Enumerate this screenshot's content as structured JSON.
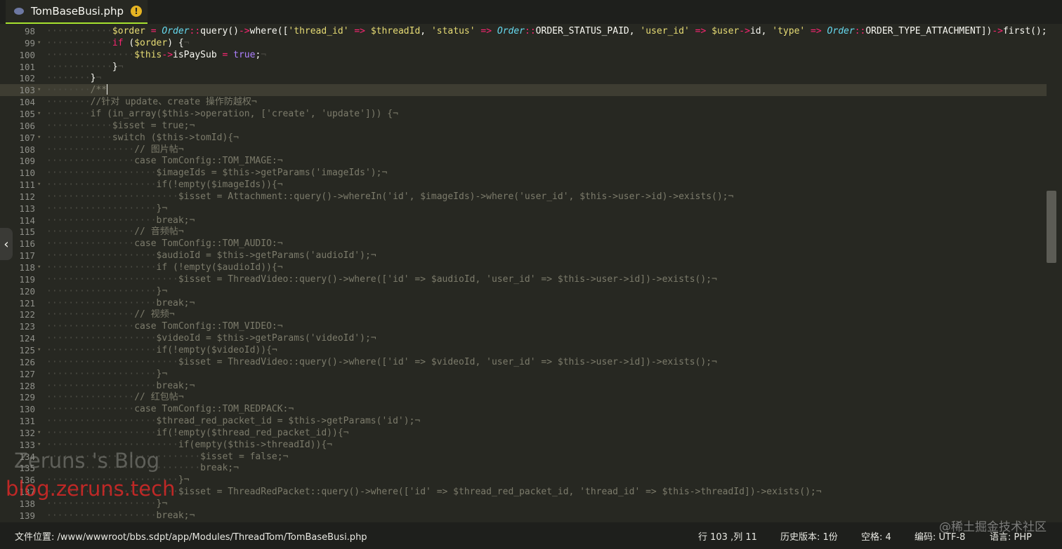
{
  "tab": {
    "filename": "TomBaseBusi.php",
    "warn_icon": "warning-icon",
    "file_icon": "php-elephant-icon"
  },
  "editor": {
    "current_line": 103,
    "lines": [
      {
        "n": "98",
        "fold": false,
        "indent": 3,
        "active": true,
        "tokens": [
          {
            "t": "$order",
            "c": "t-var"
          },
          {
            "t": " = ",
            "c": "t-op"
          },
          {
            "t": "Order",
            "c": "t-cls"
          },
          {
            "t": "::",
            "c": "t-op"
          },
          {
            "t": "query()",
            "c": "t-fn"
          },
          {
            "t": "->",
            "c": "t-op"
          },
          {
            "t": "where([",
            "c": "t-fn"
          },
          {
            "t": "'thread_id'",
            "c": "t-str"
          },
          {
            "t": " => ",
            "c": "t-op"
          },
          {
            "t": "$threadId",
            "c": "t-var"
          },
          {
            "t": ", ",
            "c": "t-pl"
          },
          {
            "t": "'status'",
            "c": "t-str"
          },
          {
            "t": " => ",
            "c": "t-op"
          },
          {
            "t": "Order",
            "c": "t-cls"
          },
          {
            "t": "::",
            "c": "t-op"
          },
          {
            "t": "ORDER_STATUS_PAID, ",
            "c": "t-pl"
          },
          {
            "t": "'user_id'",
            "c": "t-str"
          },
          {
            "t": " => ",
            "c": "t-op"
          },
          {
            "t": "$user",
            "c": "t-var"
          },
          {
            "t": "->",
            "c": "t-op"
          },
          {
            "t": "id, ",
            "c": "t-pl"
          },
          {
            "t": "'type'",
            "c": "t-str"
          },
          {
            "t": " => ",
            "c": "t-op"
          },
          {
            "t": "Order",
            "c": "t-cls"
          },
          {
            "t": "::",
            "c": "t-op"
          },
          {
            "t": "ORDER_TYPE_ATTACHMENT])",
            "c": "t-pl"
          },
          {
            "t": "->",
            "c": "t-op"
          },
          {
            "t": "first();",
            "c": "t-pl"
          }
        ]
      },
      {
        "n": "99",
        "fold": true,
        "indent": 3,
        "active": true,
        "tokens": [
          {
            "t": "if",
            "c": "t-kw"
          },
          {
            "t": " (",
            "c": "t-pl"
          },
          {
            "t": "$order",
            "c": "t-var"
          },
          {
            "t": ") {",
            "c": "t-pl"
          },
          {
            "t": "¬",
            "c": "guide"
          }
        ]
      },
      {
        "n": "100",
        "fold": false,
        "indent": 4,
        "active": true,
        "tokens": [
          {
            "t": "$this",
            "c": "t-var"
          },
          {
            "t": "->",
            "c": "t-op"
          },
          {
            "t": "isPaySub",
            "c": "t-pl"
          },
          {
            "t": " = ",
            "c": "t-op"
          },
          {
            "t": "true",
            "c": "t-const"
          },
          {
            "t": ";",
            "c": "t-pl"
          },
          {
            "t": "¬",
            "c": "guide"
          }
        ]
      },
      {
        "n": "101",
        "fold": false,
        "indent": 3,
        "active": true,
        "tokens": [
          {
            "t": "}",
            "c": "t-pl"
          },
          {
            "t": "¬",
            "c": "guide"
          }
        ]
      },
      {
        "n": "102",
        "fold": false,
        "indent": 2,
        "active": true,
        "tokens": [
          {
            "t": "}",
            "c": "t-pl"
          },
          {
            "t": "¬",
            "c": "guide"
          }
        ]
      },
      {
        "n": "103",
        "fold": true,
        "indent": 2,
        "active": true,
        "cursor": true,
        "tokens": [
          {
            "t": "/**",
            "c": "code-dim"
          }
        ]
      },
      {
        "n": "104",
        "fold": false,
        "indent": 2,
        "active": false,
        "text": "//针对 update、create 操作防越权¬"
      },
      {
        "n": "105",
        "fold": true,
        "indent": 2,
        "active": false,
        "text": "if (in_array($this->operation, ['create', 'update'])) {¬"
      },
      {
        "n": "106",
        "fold": false,
        "indent": 3,
        "active": false,
        "text": "$isset = true;¬"
      },
      {
        "n": "107",
        "fold": true,
        "indent": 3,
        "active": false,
        "text": "switch ($this->tomId){¬"
      },
      {
        "n": "108",
        "fold": false,
        "indent": 4,
        "active": false,
        "text": "// 图片帖¬"
      },
      {
        "n": "109",
        "fold": false,
        "indent": 4,
        "active": false,
        "text": "case TomConfig::TOM_IMAGE:¬"
      },
      {
        "n": "110",
        "fold": false,
        "indent": 5,
        "active": false,
        "text": "$imageIds = $this->getParams('imageIds');¬"
      },
      {
        "n": "111",
        "fold": true,
        "indent": 5,
        "active": false,
        "text": "if(!empty($imageIds)){¬"
      },
      {
        "n": "112",
        "fold": false,
        "indent": 6,
        "active": false,
        "text": "$isset = Attachment::query()->whereIn('id', $imageIds)->where('user_id', $this->user->id)->exists();¬"
      },
      {
        "n": "113",
        "fold": false,
        "indent": 5,
        "active": false,
        "text": "}¬"
      },
      {
        "n": "114",
        "fold": false,
        "indent": 5,
        "active": false,
        "text": "break;¬"
      },
      {
        "n": "115",
        "fold": false,
        "indent": 4,
        "active": false,
        "text": "// 音频帖¬"
      },
      {
        "n": "116",
        "fold": false,
        "indent": 4,
        "active": false,
        "text": "case TomConfig::TOM_AUDIO:¬"
      },
      {
        "n": "117",
        "fold": false,
        "indent": 5,
        "active": false,
        "text": "$audioId = $this->getParams('audioId');¬"
      },
      {
        "n": "118",
        "fold": true,
        "indent": 5,
        "active": false,
        "text": "if (!empty($audioId)){¬"
      },
      {
        "n": "119",
        "fold": false,
        "indent": 6,
        "active": false,
        "text": "$isset = ThreadVideo::query()->where(['id' => $audioId, 'user_id' => $this->user->id])->exists();¬"
      },
      {
        "n": "120",
        "fold": false,
        "indent": 5,
        "active": false,
        "text": "}¬"
      },
      {
        "n": "121",
        "fold": false,
        "indent": 5,
        "active": false,
        "text": "break;¬"
      },
      {
        "n": "122",
        "fold": false,
        "indent": 4,
        "active": false,
        "text": "// 视频¬"
      },
      {
        "n": "123",
        "fold": false,
        "indent": 4,
        "active": false,
        "text": "case TomConfig::TOM_VIDEO:¬"
      },
      {
        "n": "124",
        "fold": false,
        "indent": 5,
        "active": false,
        "text": "$videoId = $this->getParams('videoId');¬"
      },
      {
        "n": "125",
        "fold": true,
        "indent": 5,
        "active": false,
        "text": "if(!empty($videoId)){¬"
      },
      {
        "n": "126",
        "fold": false,
        "indent": 6,
        "active": false,
        "text": "$isset = ThreadVideo::query()->where(['id' => $videoId, 'user_id' => $this->user->id])->exists();¬"
      },
      {
        "n": "127",
        "fold": false,
        "indent": 5,
        "active": false,
        "text": "}¬"
      },
      {
        "n": "128",
        "fold": false,
        "indent": 5,
        "active": false,
        "text": "break;¬"
      },
      {
        "n": "129",
        "fold": false,
        "indent": 4,
        "active": false,
        "text": "// 红包帖¬"
      },
      {
        "n": "130",
        "fold": false,
        "indent": 4,
        "active": false,
        "text": "case TomConfig::TOM_REDPACK:¬"
      },
      {
        "n": "131",
        "fold": false,
        "indent": 5,
        "active": false,
        "text": "$thread_red_packet_id = $this->getParams('id');¬"
      },
      {
        "n": "132",
        "fold": true,
        "indent": 5,
        "active": false,
        "text": "if(!empty($thread_red_packet_id)){¬"
      },
      {
        "n": "133",
        "fold": true,
        "indent": 6,
        "active": false,
        "text": "if(empty($this->threadId)){¬"
      },
      {
        "n": "134",
        "fold": false,
        "indent": 7,
        "active": false,
        "text": "$isset = false;¬"
      },
      {
        "n": "135",
        "fold": false,
        "indent": 7,
        "active": false,
        "text": "break;¬"
      },
      {
        "n": "136",
        "fold": false,
        "indent": 6,
        "active": false,
        "text": "}¬"
      },
      {
        "n": "137",
        "fold": false,
        "indent": 6,
        "active": false,
        "text": "$isset = ThreadRedPacket::query()->where(['id' => $thread_red_packet_id, 'thread_id' => $this->threadId])->exists();¬"
      },
      {
        "n": "138",
        "fold": false,
        "indent": 5,
        "active": false,
        "text": "}¬"
      },
      {
        "n": "139",
        "fold": false,
        "indent": 5,
        "active": false,
        "text": "break;¬"
      }
    ]
  },
  "watermarks": {
    "blog_name": "Zeruns 's Blog",
    "blog_url": "blog.zeruns.tech",
    "community": "@稀土掘金技术社区"
  },
  "sidebar_toggle": {
    "icon": "chevron-left-icon",
    "glyph": "‹"
  },
  "statusbar": {
    "file_location": "文件位置: /www/wwwroot/bbs.sdpt/app/Modules/ThreadTom/TomBaseBusi.php",
    "cursor_position": "行 103 ,列 11",
    "history": "历史版本: 1份",
    "indent": "空格: 4",
    "encoding": "编码: UTF-8",
    "language": "语言: PHP"
  }
}
